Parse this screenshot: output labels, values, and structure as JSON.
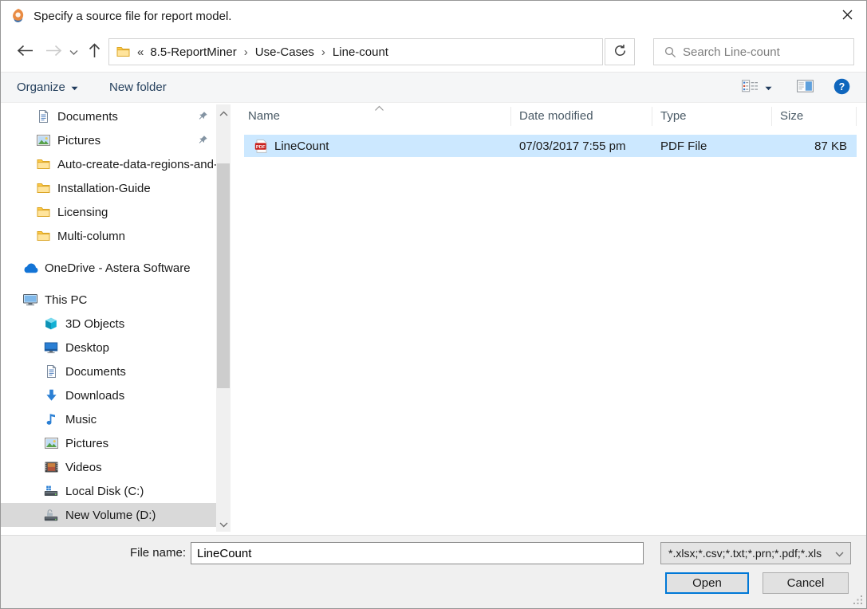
{
  "window": {
    "title": "Specify a source file for report model."
  },
  "nav": {
    "address_prefix": "«",
    "breadcrumbs": [
      "8.5-ReportMiner",
      "Use-Cases",
      "Line-count"
    ],
    "search_placeholder": "Search Line-count"
  },
  "toolbar": {
    "organize_label": "Organize",
    "new_folder_label": "New folder"
  },
  "sidebar": {
    "items": [
      {
        "label": "Documents",
        "icon": "documents-icon",
        "indent": 1,
        "pinned": true
      },
      {
        "label": "Pictures",
        "icon": "pictures-icon",
        "indent": 1,
        "pinned": true
      },
      {
        "label": "Auto-create-data-regions-and-",
        "icon": "folder-icon",
        "indent": 1
      },
      {
        "label": "Installation-Guide",
        "icon": "folder-icon",
        "indent": 1
      },
      {
        "label": "Licensing",
        "icon": "folder-icon",
        "indent": 1
      },
      {
        "label": "Multi-column",
        "icon": "folder-icon",
        "indent": 1
      },
      {
        "label": "OneDrive - Astera Software",
        "icon": "onedrive-icon",
        "indent": 0,
        "gap_before": true
      },
      {
        "label": "This PC",
        "icon": "this-pc-icon",
        "indent": 0,
        "gap_before": true
      },
      {
        "label": "3D Objects",
        "icon": "3d-objects-icon",
        "indent": 2
      },
      {
        "label": "Desktop",
        "icon": "desktop-icon",
        "indent": 2
      },
      {
        "label": "Documents",
        "icon": "documents-icon",
        "indent": 2
      },
      {
        "label": "Downloads",
        "icon": "downloads-icon",
        "indent": 2
      },
      {
        "label": "Music",
        "icon": "music-icon",
        "indent": 2
      },
      {
        "label": "Pictures",
        "icon": "pictures-icon",
        "indent": 2
      },
      {
        "label": "Videos",
        "icon": "videos-icon",
        "indent": 2
      },
      {
        "label": "Local Disk (C:)",
        "icon": "local-disk-icon",
        "indent": 2
      },
      {
        "label": "New Volume (D:)",
        "icon": "new-volume-icon",
        "indent": 2,
        "selected": true
      }
    ]
  },
  "file_list": {
    "columns": [
      "Name",
      "Date modified",
      "Type",
      "Size"
    ],
    "sorted_by": "Name",
    "rows": [
      {
        "icon": "pdf-icon",
        "name": "LineCount",
        "date_modified": "07/03/2017 7:55 pm",
        "type": "PDF File",
        "size": "87 KB",
        "selected": true
      }
    ]
  },
  "footer": {
    "file_name_label": "File name:",
    "file_name_value": "LineCount",
    "filter_value": "*.xlsx;*.csv;*.txt;*.prn;*.pdf;*.xls",
    "open_label": "Open",
    "cancel_label": "Cancel"
  },
  "colors": {
    "accent": "#0078d7",
    "row_selection": "#cce8ff",
    "sidebar_selection": "#d9d9d9",
    "toolbar_text": "#26415e"
  }
}
